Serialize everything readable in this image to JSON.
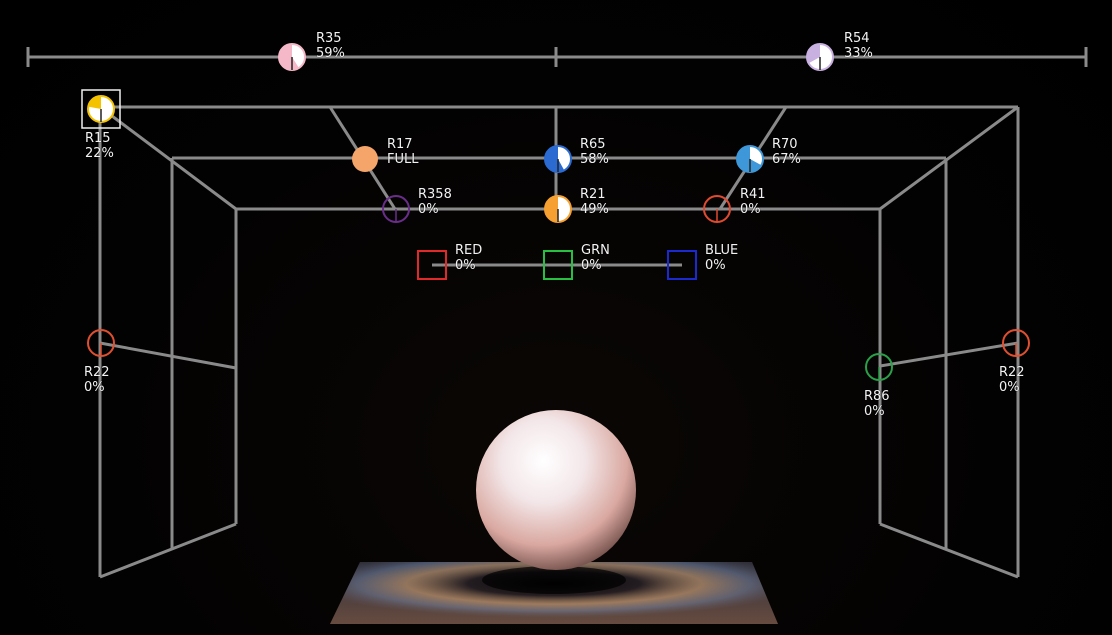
{
  "colors": {
    "rig_line": "#8a8a8a",
    "label_text": "#f2f2f2",
    "selected_outline": "#f0f0f0"
  },
  "lights": [
    {
      "id": "r35-top-left",
      "name": "R35",
      "level": "59%",
      "color": "#f5b8c8",
      "fill_fraction": 0.59
    },
    {
      "id": "r54-top-right",
      "name": "R54",
      "level": "33%",
      "color": "#c8b0e0",
      "fill_fraction": 0.33
    },
    {
      "id": "r15-corner",
      "name": "R15",
      "level": "22%",
      "color": "#f5c200",
      "fill_fraction": 0.22,
      "selected": true
    },
    {
      "id": "r17",
      "name": "R17",
      "level": "FULL",
      "color": "#f5a56a",
      "fill_fraction": 1.0
    },
    {
      "id": "r65",
      "name": "R65",
      "level": "58%",
      "color": "#2b6ad0",
      "fill_fraction": 0.58
    },
    {
      "id": "r70",
      "name": "R70",
      "level": "67%",
      "color": "#3d97d8",
      "fill_fraction": 0.67
    },
    {
      "id": "r358",
      "name": "R358",
      "level": "0%",
      "color": "#6a2e8a",
      "fill_fraction": 0
    },
    {
      "id": "r21",
      "name": "R21",
      "level": "49%",
      "color": "#f5a030",
      "fill_fraction": 0.49
    },
    {
      "id": "r41",
      "name": "R41",
      "level": "0%",
      "color": "#e04a30",
      "fill_fraction": 0
    },
    {
      "id": "red",
      "name": "RED",
      "level": "0%",
      "color": "#e02a2a",
      "fill_fraction": 0,
      "shape": "square"
    },
    {
      "id": "grn",
      "name": "GRN",
      "level": "0%",
      "color": "#28c040",
      "fill_fraction": 0,
      "shape": "square"
    },
    {
      "id": "blue",
      "name": "BLUE",
      "level": "0%",
      "color": "#1a2ad0",
      "fill_fraction": 0,
      "shape": "square"
    },
    {
      "id": "r22-left",
      "name": "R22",
      "level": "0%",
      "color": "#e05030",
      "fill_fraction": 0
    },
    {
      "id": "r86",
      "name": "R86",
      "level": "0%",
      "color": "#2aa048",
      "fill_fraction": 0
    },
    {
      "id": "r22-right",
      "name": "R22",
      "level": "0%",
      "color": "#e05030",
      "fill_fraction": 0
    }
  ]
}
